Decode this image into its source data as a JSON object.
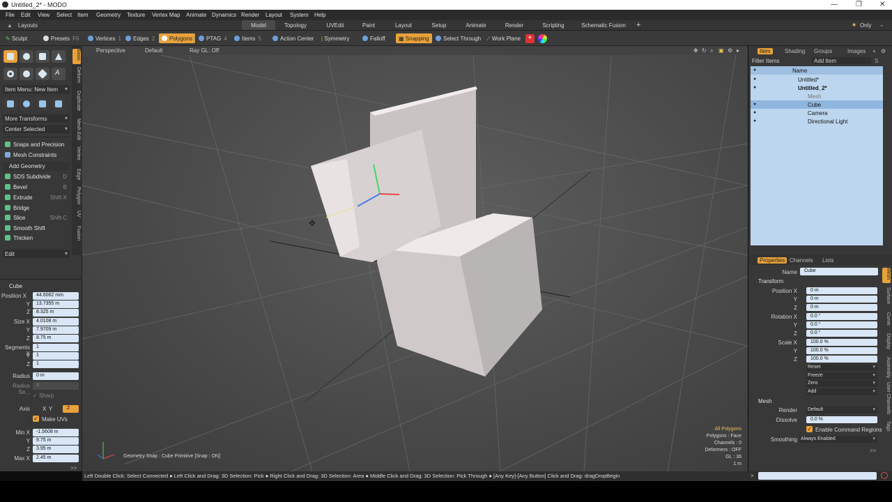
{
  "window": {
    "title": "Untitled_2* - MODO"
  },
  "menu": [
    "File",
    "Edit",
    "View",
    "Select",
    "Item",
    "Geometry",
    "Texture",
    "Vertex Map",
    "Animate",
    "Dynamics",
    "Render",
    "Layout",
    "System",
    "Help"
  ],
  "layouts": {
    "label": "Layouts",
    "tabs": [
      "Model",
      "Topology",
      "UVEdit",
      "Paint",
      "Layout",
      "Setup",
      "Animate",
      "Render",
      "Scripting",
      "Schematic Fusion"
    ],
    "active": "Model",
    "add": "+",
    "only": "Only"
  },
  "toolbar": {
    "sculpt": "Sculpt",
    "presets": "Presets",
    "presets_key": "F6",
    "vertices": "Vertices",
    "vertices_key": "1",
    "edges": "Edges",
    "edges_key": "2",
    "polygons": "Polygons",
    "polygons_key": "3",
    "ptag": "PTAG",
    "ptag_key": "4",
    "items": "Items",
    "items_key": "5",
    "action_center": "Action Center",
    "symmetry": "Symmetry",
    "falloff": "Falloff",
    "snapping": "Snapping",
    "select_through": "Select Through",
    "work_plane": "Work Plane"
  },
  "left_panel": {
    "vertical_tabs": [
      "Basic",
      "Deform",
      "Duplicate",
      "Mesh Edit",
      "Vertex",
      "Edge",
      "Polygon",
      "UV",
      "Fusion"
    ],
    "item_menu": "Item Menu: New Item",
    "more_transforms": "More Transforms",
    "center_selected": "Center Selected",
    "snaps": "Snaps and Precision",
    "mesh_constraints": "Mesh Constraints",
    "add_geometry": "Add Geometry",
    "tools": [
      {
        "label": "SDS Subdivide",
        "shortcut": "D"
      },
      {
        "label": "Bevel",
        "shortcut": "B"
      },
      {
        "label": "Extrude",
        "shortcut": "Shift-X"
      },
      {
        "label": "Bridge",
        "shortcut": ""
      },
      {
        "label": "Slice",
        "shortcut": "Shift-C"
      },
      {
        "label": "Smooth Shift",
        "shortcut": ""
      },
      {
        "label": "Thicken",
        "shortcut": ""
      }
    ],
    "edit": "Edit"
  },
  "tool_props": {
    "header": "Cube",
    "position_label": "Position X",
    "position": [
      "44.6062 mm",
      "13.7355 m",
      "8.325 m"
    ],
    "size_label": "Size X",
    "size": [
      "4.0108 m",
      "7.9709 m",
      "8.75 m"
    ],
    "segments_label": "Segments X",
    "segments": [
      "1",
      "1",
      "1"
    ],
    "radius_label": "Radius",
    "radius": "0 m",
    "radius_seg_label": "Radius Se...",
    "radius_seg": "3",
    "sharp": "Sharp",
    "axis_label": "Axis",
    "axes": [
      "X",
      "Y",
      "Z"
    ],
    "make_uvs": "Make UVs",
    "min_label": "Min X",
    "min": [
      "-1.5608 m",
      "9.75 m",
      "3.95 m"
    ],
    "max_label": "Max X",
    "max": "2.45 m",
    "yz": [
      "Y",
      "Z"
    ],
    "expand": ">>"
  },
  "viewport": {
    "perspective": "Perspective",
    "shading": "Default",
    "raygl": "Ray GL: Off",
    "snap_status": "Geometry Snap : Cube Primitive  [Snap : ON]",
    "info": [
      {
        "text": "All Polygons",
        "color": "#e8c25a"
      },
      {
        "text": "Polygons : Face",
        "color": "#d8d8d8"
      },
      {
        "text": "Channels : 0",
        "color": "#d8d8d8"
      },
      {
        "text": "Deformers : OFF",
        "color": "#d8d8d8"
      },
      {
        "text": "GL : 36",
        "color": "#d8d8d8"
      },
      {
        "text": "1 m",
        "color": "#d8d8d8"
      }
    ]
  },
  "right_panel": {
    "tabs": [
      "Item",
      "Shading",
      "Groups",
      "Images"
    ],
    "filter": "Filter Items",
    "add_item": "Add Item",
    "name_col": "Name",
    "items": [
      {
        "label": "Untitled*",
        "indent": 0,
        "sel": false
      },
      {
        "label": "Untitled_2*",
        "indent": 0,
        "sel": false
      },
      {
        "label": "Mesh",
        "indent": 1,
        "sel": false
      },
      {
        "label": "Cube",
        "indent": 1,
        "sel": true
      },
      {
        "label": "Camera",
        "indent": 1,
        "sel": false
      },
      {
        "label": "Directional Light",
        "indent": 1,
        "sel": false
      }
    ],
    "prop_tabs": [
      "Properties",
      "Channels",
      "Lists"
    ],
    "side_tabs": [
      "Mesh",
      "Surface",
      "Curve",
      "Display",
      "Assembly",
      "User Channels",
      "Tags"
    ],
    "name_label": "Name",
    "name_value": "Cube",
    "transform": "Transform",
    "position_label": "Position X",
    "position": [
      "0 m",
      "0 m",
      "0 m"
    ],
    "rotation_label": "Rotation X",
    "rotation": [
      "0.0 °",
      "0.0 °",
      "0.0 °"
    ],
    "scale_label": "Scale X",
    "scale": [
      "100.0 %",
      "100.0 %",
      "100.0 %"
    ],
    "yz": [
      "Y",
      "Z"
    ],
    "reset": "Reset",
    "freeze": "Freeze",
    "zero": "Zero",
    "add": "Add",
    "mesh": "Mesh",
    "render_label": "Render",
    "render": "Default",
    "dissolve_label": "Dissolve",
    "dissolve": "0.0 %",
    "enable_cmd": "Enable Command Regions",
    "smoothing_label": "Smoothing",
    "smoothing": "Always Enabled",
    "expand": ">>"
  },
  "status": "Left Double Click: Select Connected ● Left Click and Drag: 3D Selection: Pick ● Right Click and Drag: 3D Selection: Area ● Middle Click and Drag: 3D Selection: Pick Through ● [Any Key]-[Any Button] Click and Drag: dragDropBegin",
  "cmd_prompt": ">"
}
